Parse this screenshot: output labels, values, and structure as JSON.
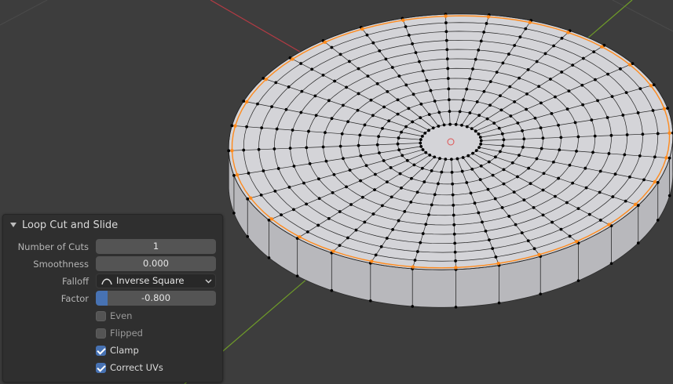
{
  "operator_panel": {
    "title": "Loop Cut and Slide",
    "fields": {
      "number_of_cuts": {
        "label": "Number of Cuts",
        "value": "1"
      },
      "smoothness": {
        "label": "Smoothness",
        "value": "0.000"
      },
      "falloff": {
        "label": "Falloff",
        "value": "Inverse Square",
        "icon": "falloff-curve-icon"
      },
      "factor": {
        "label": "Factor",
        "value": "-0.800",
        "fill_fraction": 0.1
      }
    },
    "checkboxes": {
      "even": {
        "label": "Even",
        "checked": false
      },
      "flipped": {
        "label": "Flipped",
        "checked": false
      },
      "clamp": {
        "label": "Clamp",
        "checked": true
      },
      "correct_uvs": {
        "label": "Correct UVs",
        "checked": true
      }
    }
  },
  "viewport": {
    "background": "#3d3d3d",
    "x_axis_color": "#b33b44",
    "y_axis_color": "#6f9c29",
    "mesh_face_color": "#d4d4d8",
    "mesh_side_color": "#b8b8bc",
    "selected_edge_color": "#ff8a1c",
    "vertex_color": "#000000",
    "ring_segments": 32,
    "ring_count": 12
  }
}
